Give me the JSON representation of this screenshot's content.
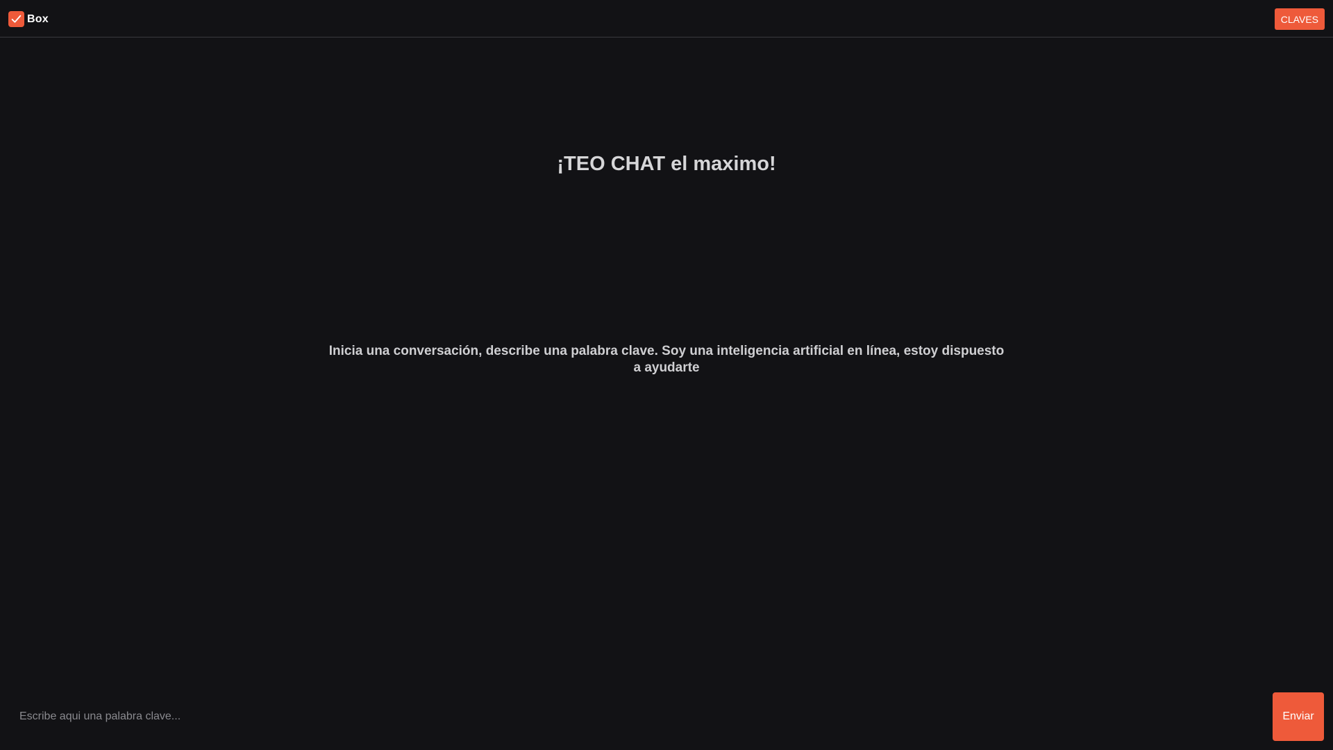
{
  "header": {
    "brand_name": "Box",
    "brand_icon": "check-icon",
    "claves_label": "CLAVES"
  },
  "main": {
    "headline": "¡TEO CHAT el maximo!",
    "intro": "Inicia una conversación, describe una palabra clave. Soy una inteligencia artificial en línea, estoy dispuesto a ayudarte"
  },
  "composer": {
    "placeholder": "Escribe aqui una palabra clave...",
    "value": "",
    "send_label": "Enviar"
  },
  "colors": {
    "accent": "#ee5a3a",
    "background": "#121215"
  }
}
